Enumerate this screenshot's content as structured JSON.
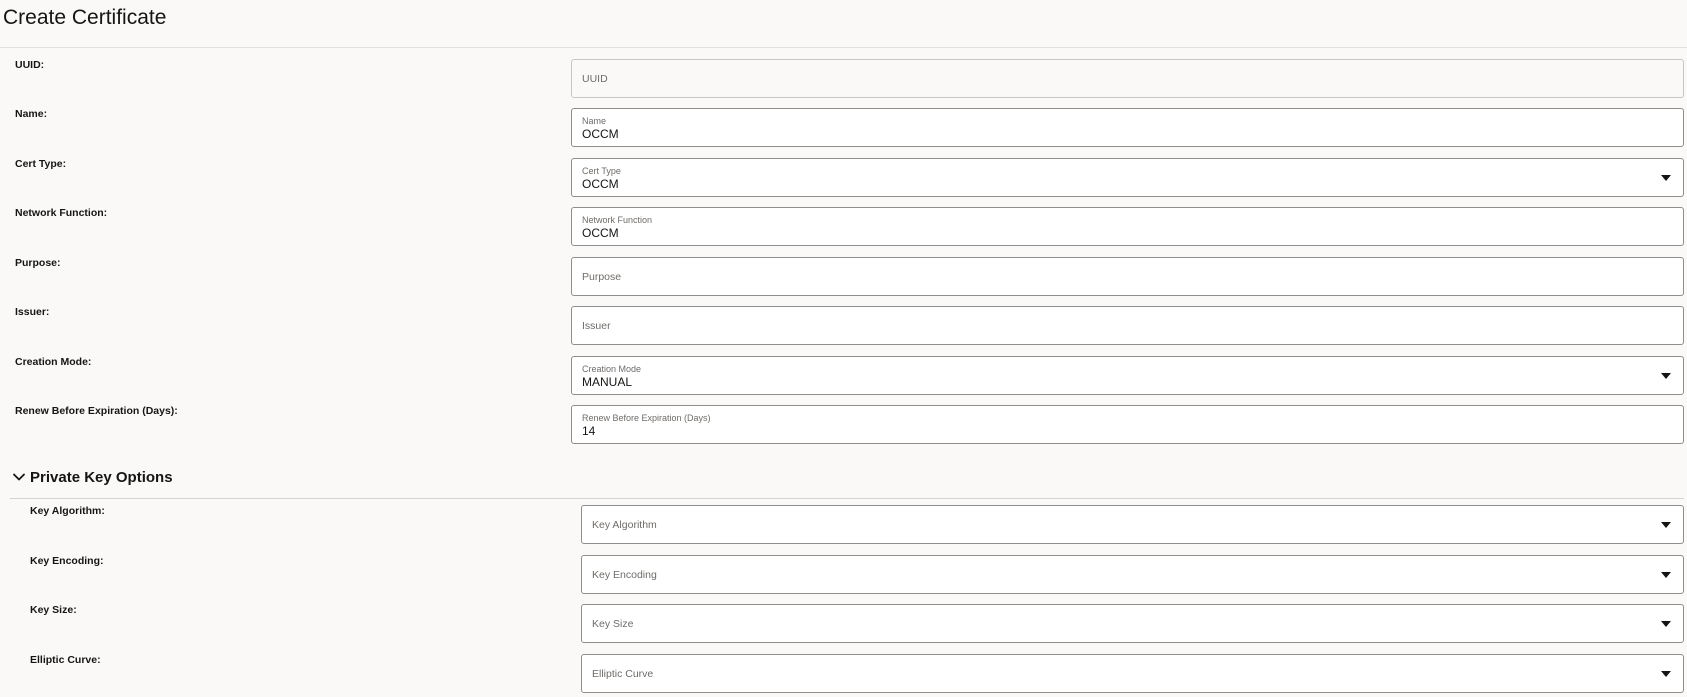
{
  "page": {
    "title": "Create Certificate"
  },
  "fields": [
    {
      "label": "UUID:",
      "placeholder": "UUID",
      "float_label": "",
      "value": ""
    },
    {
      "label": "Name:",
      "placeholder": "",
      "float_label": "Name",
      "value": "OCCM"
    },
    {
      "label": "Cert Type:",
      "placeholder": "",
      "float_label": "Cert Type",
      "value": "OCCM"
    },
    {
      "label": "Network Function:",
      "placeholder": "",
      "float_label": "Network Function",
      "value": "OCCM"
    },
    {
      "label": "Purpose:",
      "placeholder": "Purpose",
      "float_label": "",
      "value": ""
    },
    {
      "label": "Issuer:",
      "placeholder": "Issuer",
      "float_label": "",
      "value": ""
    },
    {
      "label": "Creation Mode:",
      "placeholder": "",
      "float_label": "Creation Mode",
      "value": "MANUAL"
    },
    {
      "label": "Renew Before Expiration (Days):",
      "placeholder": "",
      "float_label": "Renew Before Expiration (Days)",
      "value": "14"
    }
  ],
  "private_key_section": {
    "title": "Private Key Options",
    "expanded": true,
    "icon": "chevron-down-icon",
    "fields": [
      {
        "label": "Key Algorithm:",
        "placeholder": "Key Algorithm"
      },
      {
        "label": "Key Encoding:",
        "placeholder": "Key Encoding"
      },
      {
        "label": "Key Size:",
        "placeholder": "Key Size"
      },
      {
        "label": "Elliptic Curve:",
        "placeholder": "Elliptic Curve"
      }
    ]
  },
  "colors": {
    "background": "#faf9f8",
    "field_border": "#8f8e8c",
    "text": "#161513",
    "muted_text": "#6f6c69"
  }
}
